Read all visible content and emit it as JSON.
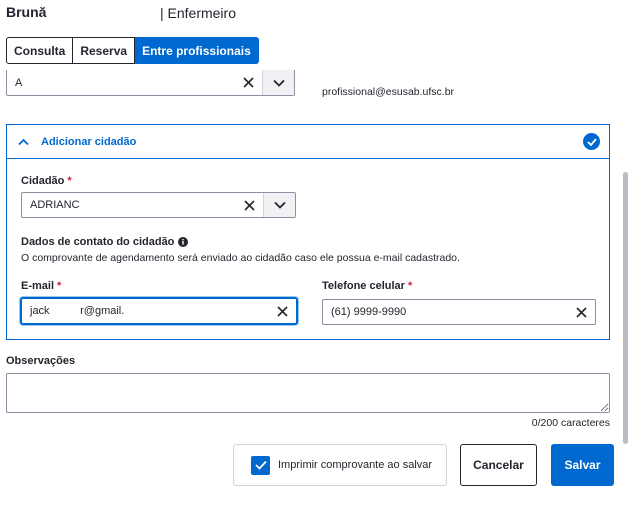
{
  "header": {
    "user_name": "Brună",
    "user_role": "| Enfermeiro"
  },
  "tabs": [
    {
      "label": "Consulta",
      "active": false
    },
    {
      "label": "Reserva",
      "active": false
    },
    {
      "label": "Entre profissionais",
      "active": true
    }
  ],
  "professional": {
    "select_value": "A",
    "email": "profissional@esusab.ufsc.br"
  },
  "citizen_panel": {
    "title": "Adicionar cidadão",
    "citizen_label": "Cidadão",
    "citizen_value": "ADRIANC",
    "contact_title": "Dados de contato do cidadão",
    "contact_description": "O comprovante de agendamento será enviado ao cidadão caso ele possua e-mail cadastrado.",
    "email_label": "E-mail",
    "email_value": "jack          r@gmail.",
    "phone_label": "Telefone celular",
    "phone_value": "(61) 9999-9990",
    "required_mark": "*"
  },
  "observations": {
    "label": "Observações",
    "value": "",
    "char_count": "0/200 caracteres"
  },
  "footer": {
    "print_label": "Imprimir comprovante ao salvar",
    "print_checked": true,
    "cancel_label": "Cancelar",
    "save_label": "Salvar"
  },
  "colors": {
    "primary": "#0069d0",
    "required": "#d01e32",
    "text": "#24252e"
  }
}
